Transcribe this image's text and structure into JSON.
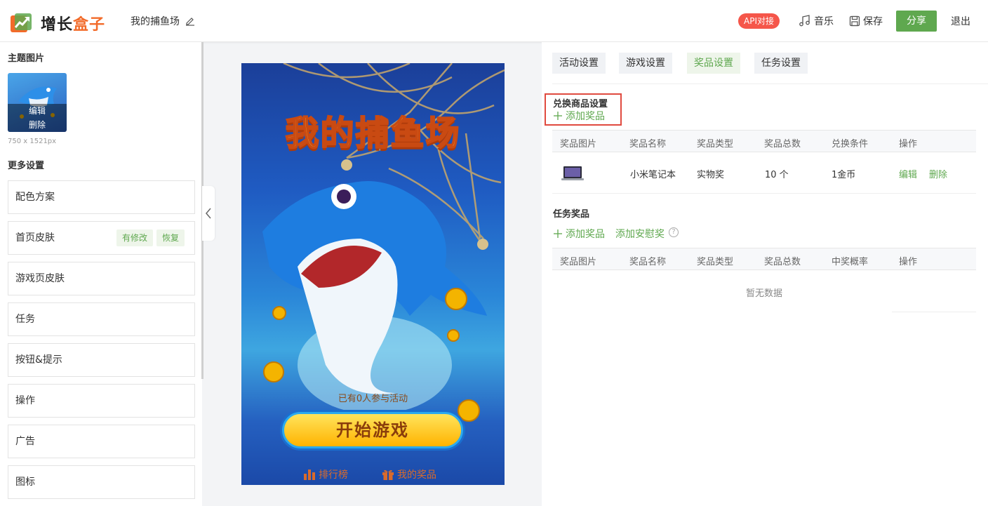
{
  "header": {
    "logo_text_main": "增长",
    "logo_text_accent": "盒子",
    "project_title": "我的捕鱼场",
    "api_badge": "API对接",
    "music_label": "音乐",
    "save_label": "保存",
    "share_label": "分享",
    "exit_label": "退出",
    "colors": {
      "accent": "#5fa84f",
      "badge": "#f5564a",
      "logo_accent": "#f26b2a"
    }
  },
  "left": {
    "theme_title": "主题图片",
    "edit_label": "编辑",
    "delete_label": "删除",
    "image_size": "750 x 1521px",
    "more_title": "更多设置",
    "menu": [
      {
        "label": "配色方案"
      },
      {
        "label": "首页皮肤",
        "tags": [
          "有修改",
          "恢复"
        ]
      },
      {
        "label": "游戏页皮肤"
      },
      {
        "label": "任务"
      },
      {
        "label": "按钮&提示"
      },
      {
        "label": "操作"
      },
      {
        "label": "广告"
      },
      {
        "label": "图标"
      }
    ]
  },
  "preview": {
    "title": "我的捕鱼场",
    "participants": "已有0人参与活动",
    "start_button": "开始游戏",
    "ranking": "排行榜",
    "my_prizes": "我的奖品"
  },
  "right": {
    "tabs": [
      {
        "label": "活动设置",
        "active": false
      },
      {
        "label": "游戏设置",
        "active": false
      },
      {
        "label": "奖品设置",
        "active": true
      },
      {
        "label": "任务设置",
        "active": false
      }
    ],
    "exchange": {
      "title": "兑换商品设置",
      "add_label": "添加奖品",
      "columns": [
        "奖品图片",
        "奖品名称",
        "奖品类型",
        "奖品总数",
        "兑换条件",
        "操作"
      ],
      "rows": [
        {
          "name": "小米笔记本",
          "type": "实物奖",
          "total": "10 个",
          "condition": "1金币",
          "edit": "编辑",
          "delete": "删除"
        }
      ]
    },
    "task": {
      "title": "任务奖品",
      "add_label": "添加奖品",
      "add_consolation_label": "添加安慰奖",
      "help": "?",
      "columns": [
        "奖品图片",
        "奖品名称",
        "奖品类型",
        "奖品总数",
        "中奖概率",
        "操作"
      ],
      "empty_text": "暂无数据"
    }
  }
}
